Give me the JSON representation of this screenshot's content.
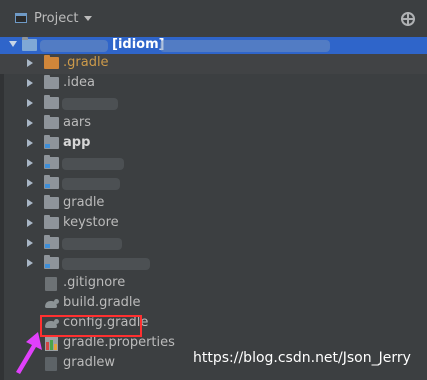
{
  "header": {
    "title": "Project",
    "icon": "project-window-icon",
    "dropdown_icon": "chevron-down-icon",
    "target_icon": "locate-crosshair-icon"
  },
  "tree": {
    "root_label": "[idiom]",
    "items": [
      {
        "label": ".gradle",
        "type": "folder",
        "color": "orange"
      },
      {
        "label": ".idea",
        "type": "folder"
      },
      {
        "label": "",
        "type": "folder"
      },
      {
        "label": "aars",
        "type": "folder"
      },
      {
        "label": "app",
        "type": "module-folder"
      },
      {
        "label": "",
        "type": "module-folder"
      },
      {
        "label": "",
        "type": "module-folder"
      },
      {
        "label": "gradle",
        "type": "folder"
      },
      {
        "label": "keystore",
        "type": "folder"
      },
      {
        "label": "",
        "type": "module-folder"
      },
      {
        "label": "",
        "type": "module-folder"
      },
      {
        "label": ".gitignore",
        "type": "file"
      },
      {
        "label": "build.gradle",
        "type": "gradle"
      },
      {
        "label": "config.gradle",
        "type": "gradle"
      },
      {
        "label": "gradle.properties",
        "type": "properties"
      },
      {
        "label": "gradlew",
        "type": "file"
      }
    ]
  },
  "watermark": "https://blog.csdn.net/Json_Jerry",
  "colors": {
    "selection": "#2f65ca",
    "highlight_box": "#ff3030",
    "pointer": "#e040fb"
  }
}
